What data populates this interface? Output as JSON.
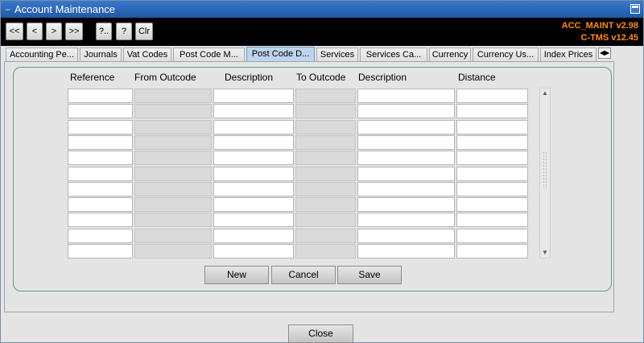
{
  "window": {
    "title": "Account Maintenance"
  },
  "toolbar": {
    "first_label": "<<",
    "prev_label": "<",
    "next_label": ">",
    "last_label": ">>",
    "query_label": "?..",
    "help_label": "?",
    "clear_label": "Clr",
    "version_line1": "ACC_MAINT v2.98",
    "version_line2": "C-TMS v12.45"
  },
  "tabs": [
    {
      "label": "Accounting Pe..."
    },
    {
      "label": "Journals"
    },
    {
      "label": "Vat Codes"
    },
    {
      "label": "Post Code M..."
    },
    {
      "label": "Post Code D...",
      "active": true
    },
    {
      "label": "Services"
    },
    {
      "label": "Services Ca..."
    },
    {
      "label": "Currency"
    },
    {
      "label": "Currency Us..."
    },
    {
      "label": "Index Prices"
    }
  ],
  "grid": {
    "columns": [
      "Reference",
      "From Outcode",
      "Description",
      "To Outcode",
      "Description",
      "Distance"
    ],
    "row_count": 11
  },
  "buttons": {
    "new_label": "New",
    "cancel_label": "Cancel",
    "save_label": "Save",
    "close_label": "Close"
  },
  "colors": {
    "titlebar": "#1f5aa8",
    "toolbar": "#000000",
    "version_text": "#ff8c1a",
    "active_tab": "#bcd4ec"
  }
}
